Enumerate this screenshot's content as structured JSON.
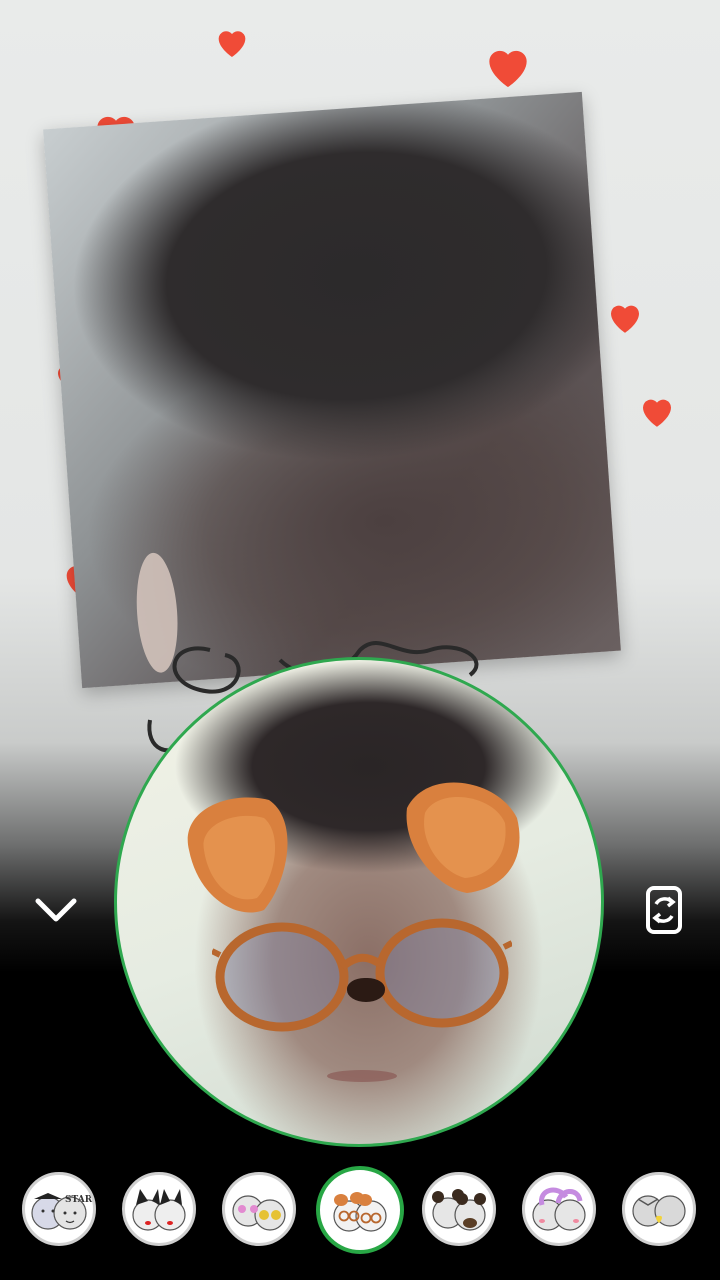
{
  "app": {
    "accent_color": "#2fa84f",
    "heart_color": "#f04b37"
  },
  "controls": {
    "collapse_icon": "chevron-down-icon",
    "switch_camera_icon": "camera-switch-icon"
  },
  "preview": {
    "active_filter": "puppy-ears-glasses"
  },
  "filters": {
    "items": [
      {
        "icon": "star-face-filter",
        "label": "STAR",
        "selected": false
      },
      {
        "icon": "cat-ears-filter",
        "label": "",
        "selected": false
      },
      {
        "icon": "heart-glasses-filter",
        "label": "",
        "selected": false
      },
      {
        "icon": "puppy-ears-glasses-filter",
        "label": "",
        "selected": true
      },
      {
        "icon": "bear-ears-filter",
        "label": "",
        "selected": false
      },
      {
        "icon": "bunny-ears-filter",
        "label": "",
        "selected": false
      },
      {
        "icon": "heart-nose-filter",
        "label": "",
        "selected": false
      }
    ]
  }
}
